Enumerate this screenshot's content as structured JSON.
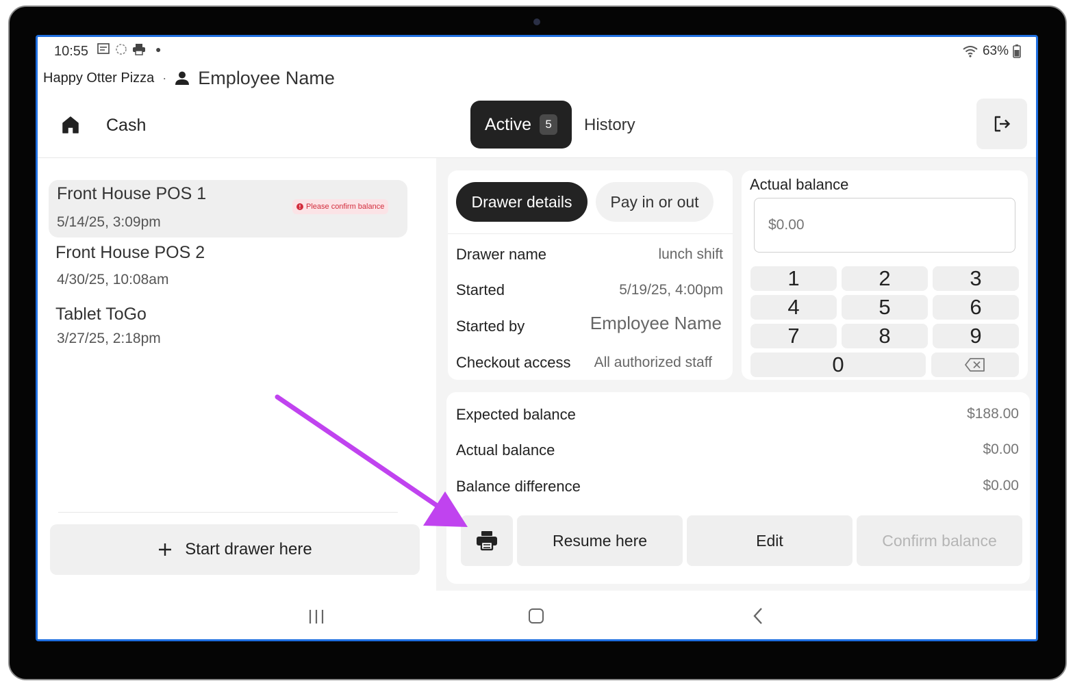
{
  "status_bar": {
    "time": "10:55",
    "battery": "63%"
  },
  "header": {
    "store_name": "Happy Otter Pizza",
    "separator": "·",
    "employee_name": "Employee Name"
  },
  "nav": {
    "page_title": "Cash",
    "tabs": [
      {
        "label": "Active",
        "count": "5"
      },
      {
        "label": "History"
      }
    ]
  },
  "drawers": [
    {
      "name": "Front House POS 1",
      "date": "5/14/25, 3:09pm",
      "badge": "Please confirm balance"
    },
    {
      "name": "Front House POS 2",
      "date": "4/30/25, 10:08am"
    },
    {
      "name": "Tablet ToGo",
      "date": "3/27/25, 2:18pm"
    }
  ],
  "start_drawer": {
    "label": "Start drawer here"
  },
  "details": {
    "tabs": [
      "Drawer details",
      "Pay in or out"
    ],
    "rows": [
      {
        "label": "Drawer name",
        "value": "lunch shift"
      },
      {
        "label": "Started",
        "value": "5/19/25, 4:00pm"
      },
      {
        "label": "Started by",
        "value": "Employee Name"
      },
      {
        "label": "Checkout access",
        "value": "All authorized staff"
      }
    ]
  },
  "actual_balance": {
    "title": "Actual balance",
    "placeholder": "$0.00",
    "keys": [
      "1",
      "2",
      "3",
      "4",
      "5",
      "6",
      "7",
      "8",
      "9",
      "0"
    ]
  },
  "summary": {
    "rows": [
      {
        "label": "Expected balance",
        "value": "$188.00"
      },
      {
        "label": "Actual balance",
        "value": "$0.00"
      },
      {
        "label": "Balance difference",
        "value": "$0.00"
      }
    ],
    "actions": {
      "resume": "Resume here",
      "edit": "Edit",
      "confirm": "Confirm balance"
    }
  },
  "colors": {
    "accent_dark": "#232323",
    "screen_border": "#1f6fe0",
    "warning": "#d22c3c",
    "annotation_arrow": "#c043ef"
  }
}
